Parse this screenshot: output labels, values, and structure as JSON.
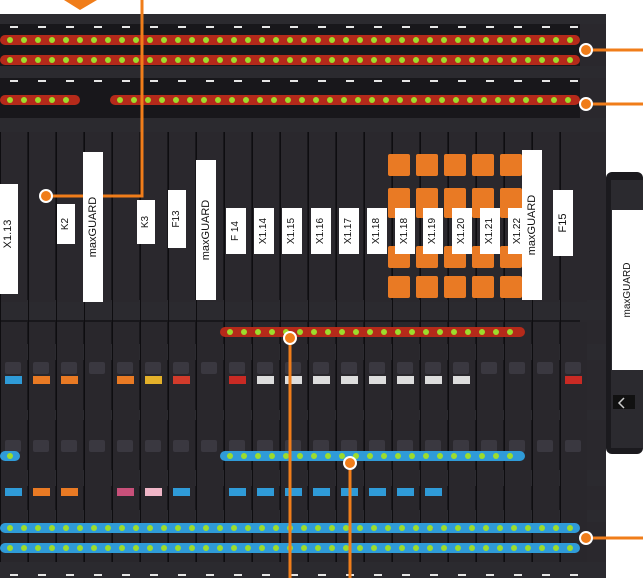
{
  "terminal_labels": {
    "x1_13": "X1.13",
    "k2": "K2",
    "k3": "K3",
    "f13": "F13",
    "f14": "F 14",
    "x1_14": "X1.14",
    "x1_15": "X1.15",
    "x1_16": "X1.16",
    "x1_17": "X1.17",
    "x1_18a": "X1.18",
    "x1_18b": "X1.18",
    "x1_19": "X1.19",
    "x1_20": "X1.20",
    "x1_21": "X1.21",
    "x1_22": "X1.22",
    "f15": "F15"
  },
  "brand_labels": {
    "marker_1": "maxGUARD",
    "marker_2": "maxGUARD",
    "marker_3": "maxGUARD",
    "side_module": "maxGUARD"
  },
  "colors": {
    "callout_orange": "#f07d1a",
    "rail_red": "#b52a1a",
    "rail_blue": "#2f9bd8",
    "led_green": "#9ddc2c",
    "module_body": "#232126",
    "handle_orange": "#e97a24"
  }
}
